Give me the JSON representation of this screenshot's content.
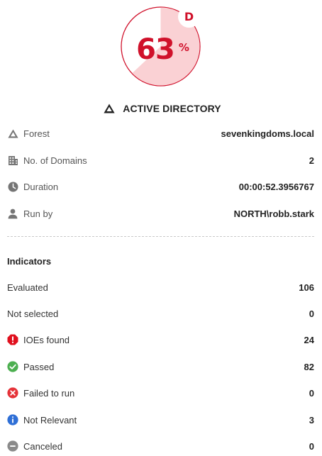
{
  "score": {
    "value": "63",
    "unit": "%",
    "percent": 63,
    "grade": "D",
    "color": "#d0112b",
    "fill_color": "#fad1d4"
  },
  "section": {
    "icon": "warning-triangle-icon",
    "title": "ACTIVE DIRECTORY"
  },
  "info": [
    {
      "icon": "forest-triangle-icon",
      "label": "Forest",
      "value": "sevenkingdoms.local"
    },
    {
      "icon": "building-icon",
      "label": "No. of Domains",
      "value": "2"
    },
    {
      "icon": "clock-icon",
      "label": "Duration",
      "value": "00:00:52.3956767"
    },
    {
      "icon": "user-icon",
      "label": "Run by",
      "value": "NORTH\\robb.stark"
    }
  ],
  "indicators": {
    "heading": "Indicators",
    "rows": [
      {
        "icon": "",
        "label": "Evaluated",
        "value": "106"
      },
      {
        "icon": "",
        "label": "Not selected",
        "value": "0"
      },
      {
        "icon": "error-octagon-icon",
        "label": "IOEs found",
        "value": "24",
        "color": "#e0101e"
      },
      {
        "icon": "check-circle-icon",
        "label": "Passed",
        "value": "82",
        "color": "#4caf50"
      },
      {
        "icon": "x-circle-icon",
        "label": "Failed to run",
        "value": "0",
        "color": "#e53238"
      },
      {
        "icon": "info-circle-icon",
        "label": "Not Relevant",
        "value": "3",
        "color": "#2f6fd6"
      },
      {
        "icon": "minus-circle-icon",
        "label": "Canceled",
        "value": "0",
        "color": "#8a8a8a"
      }
    ]
  }
}
